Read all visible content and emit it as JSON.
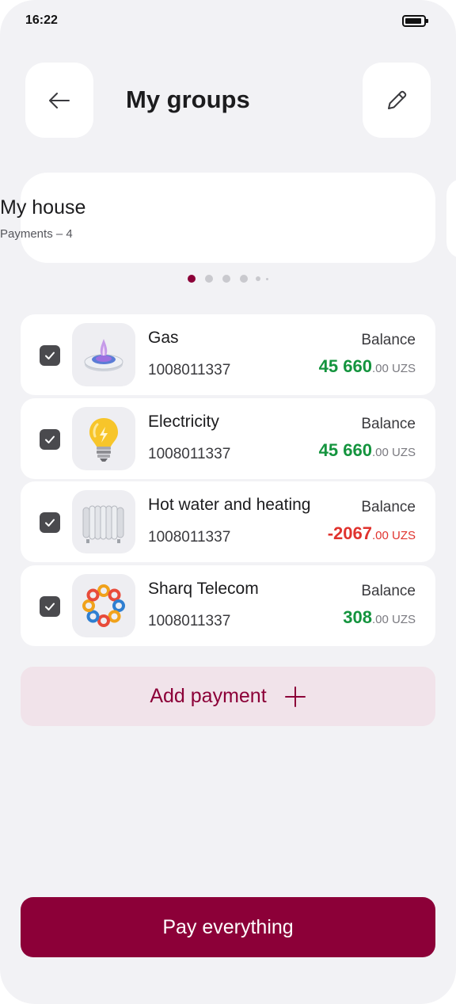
{
  "status_bar": {
    "time": "16:22"
  },
  "header": {
    "title": "My groups",
    "back_icon": "arrow-left-icon",
    "edit_icon": "pencil-icon"
  },
  "group": {
    "name": "My house",
    "subtitle": "Payments – 4"
  },
  "carousel": {
    "active_index": 0,
    "count": 5
  },
  "payments": [
    {
      "title": "Gas",
      "account": "1008011337",
      "balance_label": "Balance",
      "amount_main": "45 660",
      "amount_dec": ".00 UZS",
      "sign": "positive",
      "icon": "gas-burner-icon",
      "checked": true
    },
    {
      "title": "Electricity",
      "account": "1008011337",
      "balance_label": "Balance",
      "amount_main": "45 660",
      "amount_dec": ".00 UZS",
      "sign": "positive",
      "icon": "light-bulb-icon",
      "checked": true
    },
    {
      "title": "Hot water and heating",
      "account": "1008011337",
      "balance_label": "Balance",
      "amount_main": "-2067",
      "amount_dec": ".00 UZS",
      "sign": "negative",
      "icon": "radiator-icon",
      "checked": true
    },
    {
      "title": "Sharq Telecom",
      "account": "1008011337",
      "balance_label": "Balance",
      "amount_main": "308",
      "amount_dec": ".00 UZS",
      "sign": "positive",
      "icon": "sharq-telecom-logo-icon",
      "checked": true
    }
  ],
  "actions": {
    "add_payment": "Add payment",
    "pay_everything": "Pay everything"
  },
  "colors": {
    "brand": "#8c0038",
    "positive": "#14943e",
    "negative": "#e0332e",
    "background": "#f2f2f5"
  }
}
